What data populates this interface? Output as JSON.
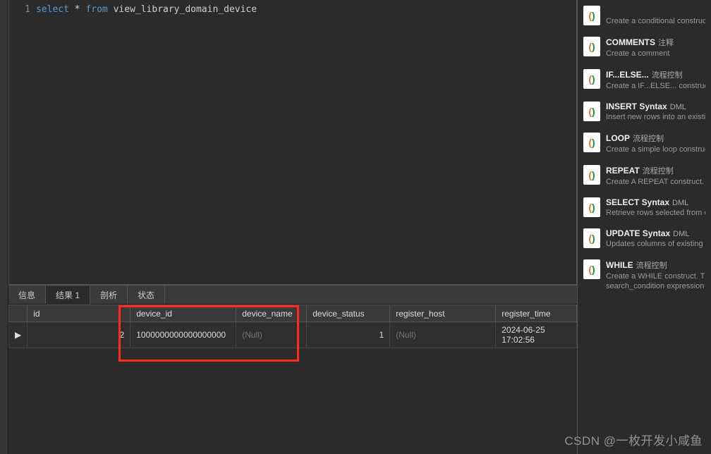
{
  "editor": {
    "line_no": "1",
    "kw_select": "select",
    "star": "*",
    "kw_from": "from",
    "table": "view_library_domain_device"
  },
  "tabs": {
    "_note": "bottom panel tabs left→right",
    "t0": "信息",
    "t1": "结果 1",
    "t2": "剖析",
    "t3": "状态"
  },
  "grid": {
    "_note": "columns left→right then one data row",
    "cols": {
      "c0": "id",
      "c1": "device_id",
      "c2": "device_name",
      "c3": "device_status",
      "c4": "register_host",
      "c5": "register_time"
    },
    "row": {
      "marker": "▶",
      "id": "2",
      "device_id": "1000000000000000000",
      "device_name": "(Null)",
      "device_status": "1",
      "register_host": "(Null)",
      "register_time": "2024-06-25 17:02:56"
    }
  },
  "snips": {
    "s0": {
      "title": "",
      "cat": "",
      "desc": "Create a conditional construct"
    },
    "s1": {
      "title": "COMMENTS",
      "cat": "注释",
      "desc": "Create a comment"
    },
    "s2": {
      "title": "IF...ELSE...",
      "cat": "流程控制",
      "desc": "Create a IF...ELSE... construct"
    },
    "s3": {
      "title": "INSERT Syntax",
      "cat": "DML",
      "desc": "Insert new rows into an existing t"
    },
    "s4": {
      "title": "LOOP",
      "cat": "流程控制",
      "desc": "Create a simple loop construct"
    },
    "s5": {
      "title": "REPEAT",
      "cat": "流程控制",
      "desc": "Create A REPEAT construct. The S"
    },
    "s6": {
      "title": "SELECT Syntax",
      "cat": "DML",
      "desc": "Retrieve rows selected from one o"
    },
    "s7": {
      "title": "UPDATE Syntax",
      "cat": "DML",
      "desc": "Updates columns of existing row"
    },
    "s8": {
      "title": "WHILE",
      "cat": "流程控制",
      "desc": "Create a WHILE construct. The sta"
    },
    "s8b": {
      "desc": "search_condition expression is tru"
    }
  },
  "watermark": "CSDN @一枚开发小咸鱼"
}
